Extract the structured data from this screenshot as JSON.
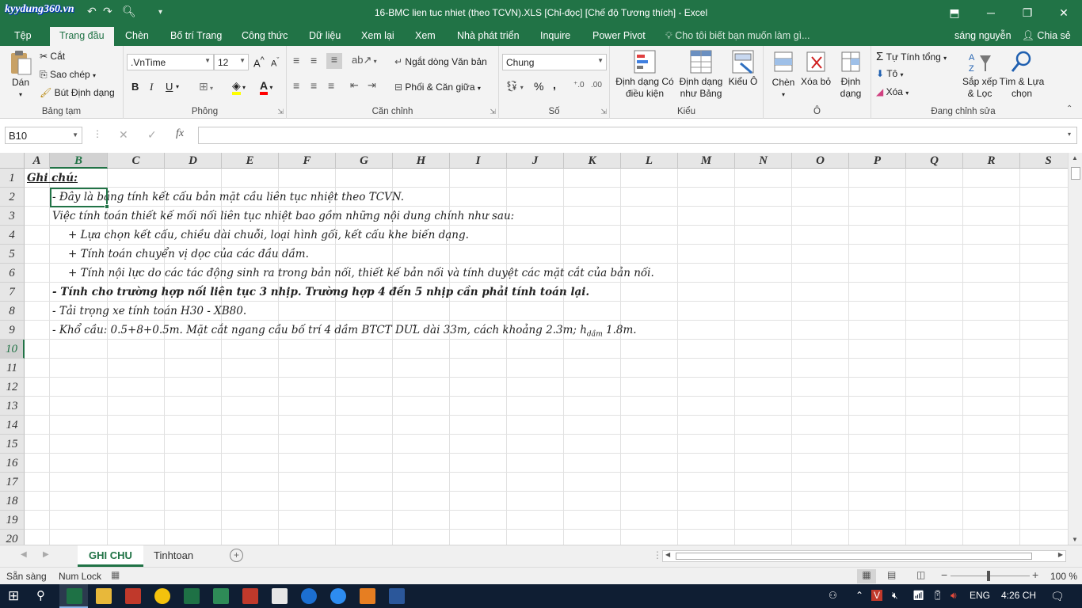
{
  "window": {
    "title": "16-BMC lien tuc nhiet (theo TCVN).XLS  [Chỉ-đọc]  [Chế độ Tương thích] - Excel",
    "watermark": "kyydung360.vn"
  },
  "ribbon_tabs": [
    "Tệp",
    "Trang đầu",
    "Chèn",
    "Bố trí Trang",
    "Công thức",
    "Dữ liệu",
    "Xem lại",
    "Xem",
    "Nhà phát triển",
    "Inquire",
    "Power Pivot"
  ],
  "tell_me": "Cho tôi biết bạn muốn làm gì...",
  "user": "sáng nguyễn",
  "share": "Chia sẻ",
  "clipboard": {
    "paste": "Dán",
    "cut": "Cắt",
    "copy": "Sao chép",
    "format_painter": "Bút Định dạng",
    "label": "Bảng tạm"
  },
  "font": {
    "name": ".VnTime",
    "size": "12",
    "bold": "B",
    "italic": "I",
    "underline": "U",
    "label": "Phông"
  },
  "alignment": {
    "wrap": "Ngắt dòng Văn bản",
    "merge": "Phối & Căn giữa",
    "label": "Căn chỉnh"
  },
  "number": {
    "format": "Chung",
    "percent": "%",
    "comma": ",",
    "label": "Số"
  },
  "styles": {
    "conditional": "Định dạng Có điều kiện",
    "as_table": "Định dạng như Bảng",
    "cell_styles": "Kiểu Ô",
    "label": "Kiểu"
  },
  "cells": {
    "insert": "Chèn",
    "delete": "Xóa bỏ",
    "format": "Định dạng",
    "label": "Ô"
  },
  "editing": {
    "autosum": "Tự Tính tổng",
    "fill": "Tô",
    "clear": "Xóa",
    "sort": "Sắp xếp & Lọc",
    "find": "Tìm & Lựa chọn",
    "label": "Đang chỉnh sửa"
  },
  "formula_bar": {
    "name_box": "B10",
    "fx": "fx",
    "content": ""
  },
  "columns": [
    "A",
    "B",
    "C",
    "D",
    "E",
    "F",
    "G",
    "H",
    "I",
    "J",
    "K",
    "L",
    "M",
    "N",
    "O",
    "P",
    "Q",
    "R",
    "S"
  ],
  "rows": [
    "1",
    "2",
    "3",
    "4",
    "5",
    "6",
    "7",
    "8",
    "9",
    "10",
    "11",
    "12",
    "13",
    "14",
    "15",
    "16",
    "17",
    "18",
    "19",
    "20"
  ],
  "sheet_rows": [
    {
      "text": "Ghi chú:"
    },
    {
      "text": "- Đây là bảng tính kết cấu bản mặt cầu liên tục nhiệt theo TCVN."
    },
    {
      "text": "Việc tính toán thiết kế mối nối liên tục nhiệt bao gồm những nội dung chính như sau:"
    },
    {
      "text": "+ Lựa chọn kết cấu, chiều dài chuỗi, loại hình gối, kết cấu khe biến dạng."
    },
    {
      "text": "+ Tính toán chuyển vị dọc của các đầu dầm."
    },
    {
      "text": "+ Tính nội lực do các tác động sinh ra trong bản nối, thiết kế bản nối và tính duyệt các mặt cắt của bản nối."
    },
    {
      "text": "- Tính cho trường hợp nối liên tục 3 nhịp. Trường hợp 4 đến 5 nhịp cần phải tính toán lại."
    },
    {
      "text": "- Tải trọng xe tính toán H30 - XB80."
    },
    {
      "text": "- Khổ cầu: 0.5+8+0.5m. Mặt cắt ngang cầu bố trí 4 dầm BTCT DƯL dài 33m, cách khoảng 2.3m; h",
      "sub": "dầm",
      "tail": " 1.8m."
    }
  ],
  "sheets": [
    "GHI CHU",
    "Tinhtoan"
  ],
  "status": {
    "ready": "Sẵn sàng",
    "numlock": "Num Lock",
    "zoom": "100 %"
  },
  "taskbar": {
    "lang": "ENG",
    "time": "4:26 CH"
  }
}
